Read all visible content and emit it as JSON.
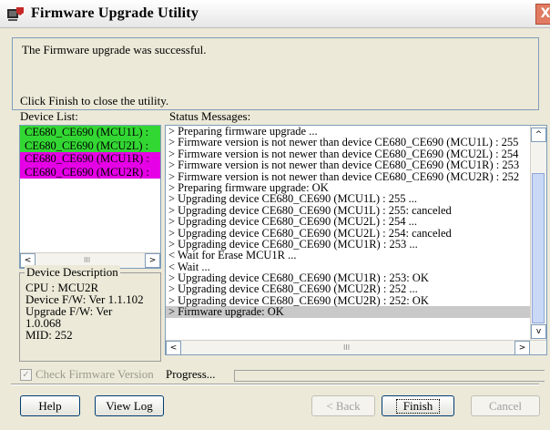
{
  "window": {
    "title": "Firmware Upgrade Utility",
    "close_label": "X"
  },
  "message": {
    "line1": "The Firmware upgrade was successful.",
    "line2": "Click Finish to close the utility."
  },
  "device_list": {
    "label": "Device List:",
    "items": [
      {
        "text": "CE680_CE690 (MCU1L) :",
        "color": "#33d733"
      },
      {
        "text": "CE680_CE690 (MCU2L) :",
        "color": "#33d733"
      },
      {
        "text": "CE680_CE690 (MCU1R) :",
        "color": "#e600e6"
      },
      {
        "text": "CE680_CE690 (MCU2R) :",
        "color": "#e600e6"
      }
    ],
    "scroll_left": "<",
    "scroll_right": ">",
    "scroll_grip": "III"
  },
  "device_description": {
    "legend": "Device Description",
    "lines": [
      "CPU : MCU2R",
      "Device F/W: Ver 1.1.102",
      "Upgrade F/W: Ver",
      "1.0.068",
      "MID: 252"
    ]
  },
  "status": {
    "label": "Status Messages:",
    "lines": [
      "> Preparing firmware upgrade ...",
      "> Firmware version is not newer than device CE680_CE690 (MCU1L) : 255",
      "> Firmware version is not newer than device CE680_CE690 (MCU2L) : 254",
      "> Firmware version is not newer than device CE680_CE690 (MCU1R) : 253",
      "> Firmware version is not newer than device CE680_CE690 (MCU2R) : 252",
      "> Preparing firmware upgrade: OK",
      "> Upgrading device CE680_CE690 (MCU1L) : 255 ...",
      "> Upgrading device CE680_CE690 (MCU1L) : 255: canceled",
      "> Upgrading device CE680_CE690 (MCU2L) : 254 ...",
      "> Upgrading device CE680_CE690 (MCU2L) : 254: canceled",
      "> Upgrading device CE680_CE690 (MCU1R) : 253 ...",
      "< Wait for Erase MCU1R ...",
      "< Wait ...",
      "> Upgrading device CE680_CE690 (MCU1R) : 253: OK",
      "> Upgrading device CE680_CE690 (MCU2R) : 252 ...",
      "> Upgrading device CE680_CE690 (MCU2R) : 252: OK",
      "> Firmware upgrade: OK"
    ],
    "selected_index": 16,
    "scroll_up": "^",
    "scroll_down": "v",
    "scroll_left": "<",
    "scroll_right": ">",
    "scroll_grip": "III"
  },
  "options": {
    "check_firmware_label": "Check Firmware Version",
    "check_firmware_checked": true,
    "check_mark": "✓",
    "progress_label": "Progress..."
  },
  "buttons": {
    "help": "Help",
    "view_log": "View Log",
    "back": "< Back",
    "finish": "Finish",
    "cancel": "Cancel"
  }
}
